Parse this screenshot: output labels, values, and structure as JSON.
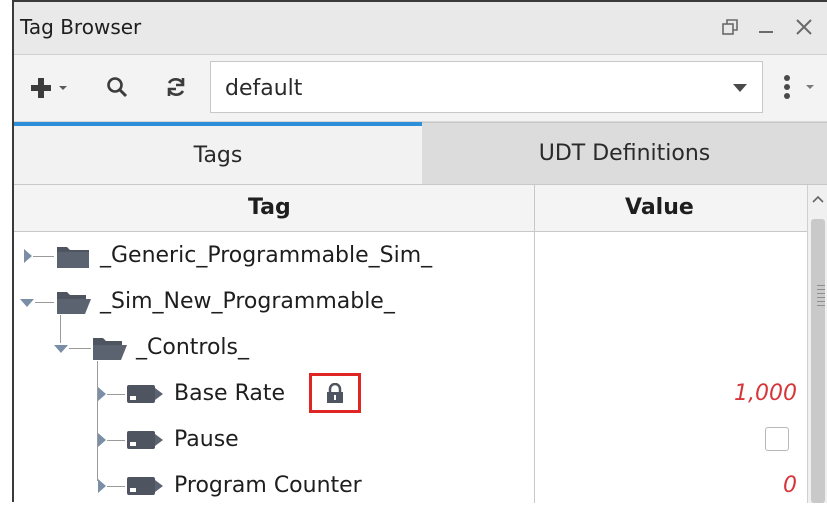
{
  "window": {
    "title": "Tag Browser"
  },
  "toolbar": {
    "add_icon": "plus-icon",
    "search_icon": "search-icon",
    "refresh_icon": "refresh-icon",
    "provider_value": "default",
    "menu_icon": "vertical-ellipsis-icon"
  },
  "tabs": [
    {
      "label": "Tags",
      "active": true
    },
    {
      "label": "UDT Definitions",
      "active": false
    }
  ],
  "table": {
    "columns": [
      "Tag",
      "Value"
    ],
    "rows": [
      {
        "label": "_Generic_Programmable_Sim_",
        "type": "folder",
        "expanded": false,
        "value": ""
      },
      {
        "label": "_Sim_New_Programmable_",
        "type": "folder",
        "expanded": true,
        "value": ""
      },
      {
        "label": "_Controls_",
        "type": "folder",
        "expanded": true,
        "value": ""
      },
      {
        "label": "Base Rate",
        "type": "tag",
        "expanded": false,
        "value": "1,000",
        "locked": true
      },
      {
        "label": "Pause",
        "type": "tag",
        "expanded": false,
        "value": "",
        "checkbox": true
      },
      {
        "label": "Program Counter",
        "type": "tag",
        "expanded": false,
        "value": "0"
      }
    ]
  },
  "colors": {
    "accent": "#2d8fd9",
    "value_text": "#d6363a",
    "highlight_box": "#e02525"
  }
}
